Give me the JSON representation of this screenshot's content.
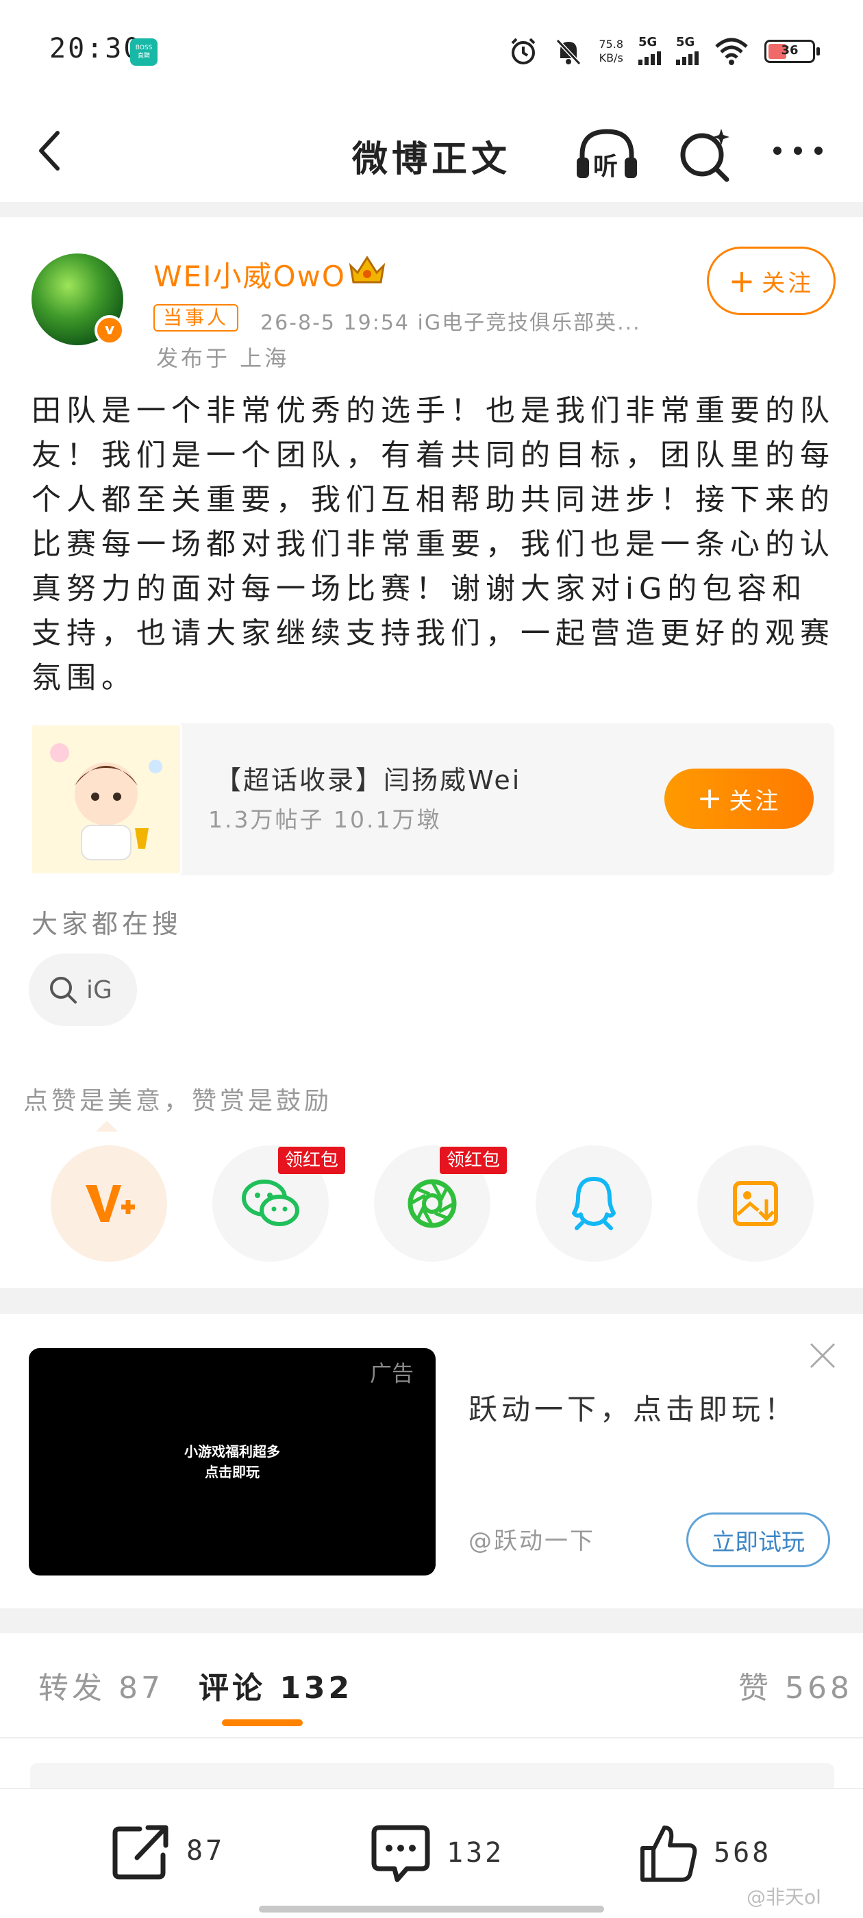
{
  "status_bar": {
    "time": "20:30",
    "app_badge": "BOSS\n直聘",
    "net_speed": "75.8\nKB/s",
    "sim1": "5G",
    "sim2": "5G",
    "battery": "36"
  },
  "nav": {
    "title": "微博正文",
    "listen_label": "听"
  },
  "author": {
    "name": "WEI小威OwO",
    "verified_badge": "v",
    "tag": "当事人",
    "meta": "26-8-5 19:54  iG电子竞技俱乐部英...",
    "location": "发布于 上海",
    "follow_label": "关注"
  },
  "post": {
    "text": "田队是一个非常优秀的选手！也是我们非常重要的队友！我们是一个团队，有着共同的目标，团队里的每个人都至关重要，我们互相帮助共同进步！接下来的比赛每一场都对我们非常重要，我们也是一条心的认真努力的面对每一场比赛！谢谢大家对iG的包容和支持，也请大家继续支持我们，一起营造更好的观赛氛围。"
  },
  "super_topic": {
    "title": "【超话收录】闫扬威Wei",
    "stats": "1.3万帖子 10.1万墩",
    "follow_label": "关注"
  },
  "search": {
    "heading": "大家都在搜",
    "chip": "iG"
  },
  "reward": {
    "hint": "点赞是美意，赞赏是鼓励",
    "redpack_label": "领红包",
    "share_targets": [
      "vplus-icon",
      "wechat-icon",
      "moments-icon",
      "qq-icon",
      "save-image-icon"
    ]
  },
  "ad": {
    "label": "广告",
    "caption": "小游戏福利超多\n点击即玩",
    "title": "跃动一下，点击即玩！",
    "source": "@跃动一下",
    "button": "立即试玩"
  },
  "tabs": {
    "repost": "转发 87",
    "comment": "评论 132",
    "like": "赞 568"
  },
  "bottom_bar": {
    "repost_count": "87",
    "comment_count": "132",
    "like_count": "568"
  },
  "watermark": "@非天ol",
  "colors": {
    "accent": "#ff8200",
    "redpack": "#e6141e",
    "wechat": "#1fbf5a",
    "qq": "#12b7f5",
    "ad_button": "#3d86c6"
  }
}
